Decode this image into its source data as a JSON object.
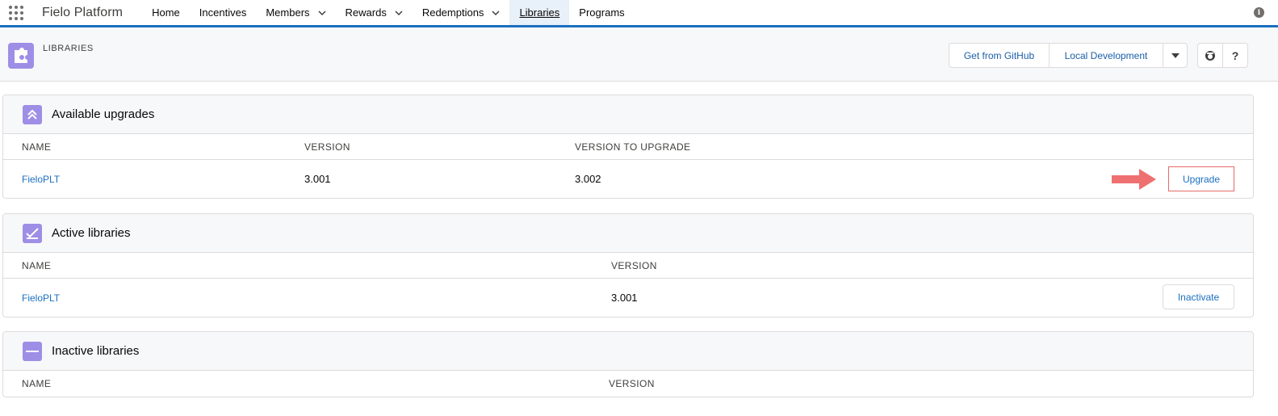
{
  "nav": {
    "app_name": "Fielo Platform",
    "items": [
      {
        "label": "Home"
      },
      {
        "label": "Incentives"
      },
      {
        "label": "Members"
      },
      {
        "label": "Rewards"
      },
      {
        "label": "Redemptions"
      },
      {
        "label": "Libraries"
      },
      {
        "label": "Programs"
      }
    ],
    "info_icon": "i"
  },
  "header": {
    "title": "LIBRARIES",
    "buttons": {
      "github": "Get from GitHub",
      "local": "Local Development",
      "help": "?"
    }
  },
  "sections": {
    "upgrades": {
      "title": "Available upgrades",
      "columns": {
        "name": "NAME",
        "version": "VERSION",
        "version_to_upgrade": "VERSION TO UPGRADE"
      },
      "row": {
        "name": "FieloPLT",
        "version": "3.001",
        "version_to_upgrade": "3.002",
        "action": "Upgrade"
      }
    },
    "active": {
      "title": "Active libraries",
      "columns": {
        "name": "NAME",
        "version": "VERSION"
      },
      "row": {
        "name": "FieloPLT",
        "version": "3.001",
        "action": "Inactivate"
      }
    },
    "inactive": {
      "title": "Inactive libraries",
      "columns": {
        "name": "NAME",
        "version": "VERSION"
      }
    }
  },
  "colors": {
    "accent": "#1b6fc0",
    "icon_purple": "#9e8ee6",
    "highlight_red": "#e46a69",
    "annotation_arrow": "#ef7070"
  }
}
